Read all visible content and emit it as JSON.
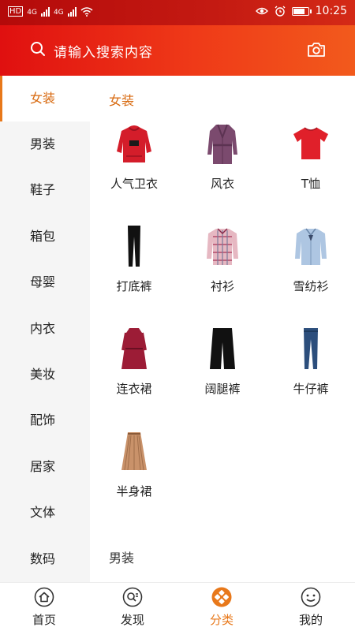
{
  "status_bar": {
    "left_text_1": "HD",
    "left_text_2": "4G",
    "left_text_3": "4G",
    "time": "10:25"
  },
  "search": {
    "placeholder": "请输入搜索内容",
    "icons": [
      "search-icon",
      "camera-icon"
    ]
  },
  "sidebar": {
    "items": [
      {
        "label": "女装",
        "active": true
      },
      {
        "label": "男装"
      },
      {
        "label": "鞋子"
      },
      {
        "label": "箱包"
      },
      {
        "label": "母婴"
      },
      {
        "label": "内衣"
      },
      {
        "label": "美妆"
      },
      {
        "label": "配饰"
      },
      {
        "label": "居家"
      },
      {
        "label": "文体"
      },
      {
        "label": "数码"
      }
    ]
  },
  "main": {
    "current_section": "女装",
    "next_section": "男装",
    "items": [
      {
        "label": "人气卫衣",
        "icon": "red-hoodie-icon"
      },
      {
        "label": "风衣",
        "icon": "trench-coat-icon"
      },
      {
        "label": "T恤",
        "icon": "red-tshirt-icon"
      },
      {
        "label": "打底裤",
        "icon": "black-leggings-icon"
      },
      {
        "label": "衬衫",
        "icon": "plaid-shirt-icon"
      },
      {
        "label": "雪纺衫",
        "icon": "chiffon-blouse-icon"
      },
      {
        "label": "连衣裙",
        "icon": "red-dress-icon"
      },
      {
        "label": "阔腿裤",
        "icon": "wide-pants-icon"
      },
      {
        "label": "牛仔裤",
        "icon": "jeans-icon"
      },
      {
        "label": "半身裙",
        "icon": "pleated-skirt-icon"
      }
    ]
  },
  "tabs": [
    {
      "label": "首页",
      "icon": "home-icon"
    },
    {
      "label": "发现",
      "icon": "discover-icon"
    },
    {
      "label": "分类",
      "icon": "category-icon",
      "active": true
    },
    {
      "label": "我的",
      "icon": "profile-icon"
    }
  ],
  "colors": {
    "accent": "#e8781a",
    "header_red": "#e01010",
    "header_orange": "#f25a1c"
  }
}
